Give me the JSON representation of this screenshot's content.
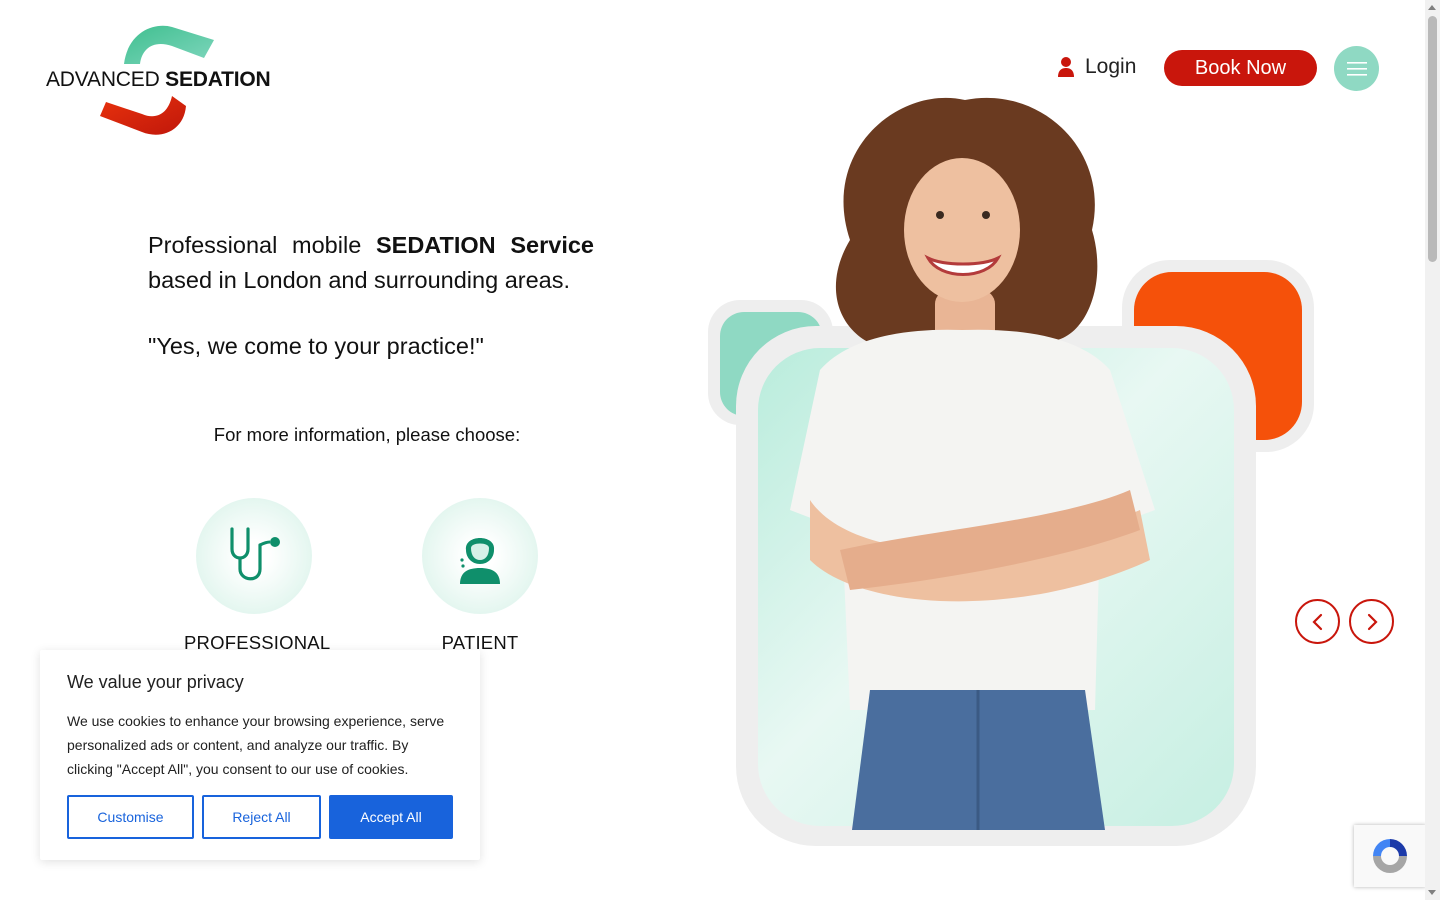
{
  "brand": {
    "name_light": "ADVANCED",
    "name_bold": "SEDATION",
    "logo_icon": "s-swoosh-logo"
  },
  "header": {
    "login_label": "Login",
    "login_icon": "user-icon",
    "book_label": "Book Now",
    "menu_icon": "hamburger-icon"
  },
  "hero": {
    "intro_words": [
      "Professional",
      "mobile"
    ],
    "intro_bold": [
      "SEDATION",
      "Service"
    ],
    "intro_line2": "based in London and surrounding areas.",
    "quote": "\"Yes, we come to your practice!\"",
    "choose": "For more information, please choose:"
  },
  "roles": [
    {
      "label": "PROFESSIONAL",
      "icon": "stethoscope-icon"
    },
    {
      "label": "PATIENT",
      "icon": "patient-icon"
    }
  ],
  "carousel": {
    "prev_icon": "chevron-left-icon",
    "next_icon": "chevron-right-icon"
  },
  "cookie": {
    "title": "We value your privacy",
    "text": "We use cookies to enhance your browsing experience, serve personalized ads or content, and analyze our traffic. By clicking \"Accept All\", you consent to our use of cookies.",
    "customise": "Customise",
    "reject": "Reject All",
    "accept": "Accept All"
  },
  "colors": {
    "brand_red": "#c9160c",
    "brand_teal": "#8fd9c3",
    "accent_orange": "#f5510a",
    "cookie_blue": "#1863dc",
    "icon_green": "#0f8f6b"
  }
}
